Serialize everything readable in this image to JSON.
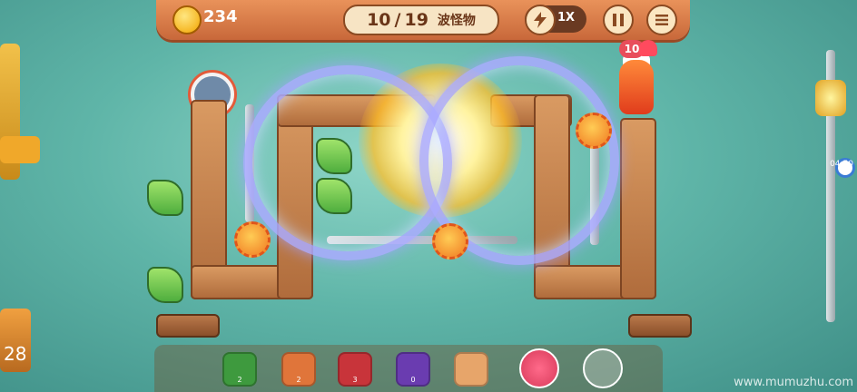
{
  "hud": {
    "gold": "234",
    "wave_current": "10",
    "wave_separator": "/",
    "wave_total": "19",
    "wave_label": "波怪物",
    "speed_label": "1X",
    "bolt_icon": "lightning-icon",
    "pause_icon": "pause-icon",
    "menu_icon": "menu-icon"
  },
  "carrot": {
    "hp": "10"
  },
  "video": {
    "elapsed": "28",
    "side_time": "04:50",
    "watermark": "www.mumuzhu.com"
  },
  "towers_bar": [
    {
      "name": "flag-tower",
      "color": "#3e9a3e",
      "cost": "2"
    },
    {
      "name": "poop-tower",
      "color": "#e0753a",
      "cost": "2"
    },
    {
      "name": "bomb-tower",
      "color": "#c8343a",
      "cost": "3"
    },
    {
      "name": "funnel-tower",
      "color": "#6a3cb0",
      "cost": "0"
    },
    {
      "name": "add-slot",
      "color": "#e7a56a",
      "cost": ""
    }
  ],
  "colors": {
    "topbar": "#d57a45",
    "wall": "#c27f4b",
    "monster_orange": "#f07a22",
    "monster_green": "#5fbf45",
    "swirl": "#a9a9ff"
  }
}
